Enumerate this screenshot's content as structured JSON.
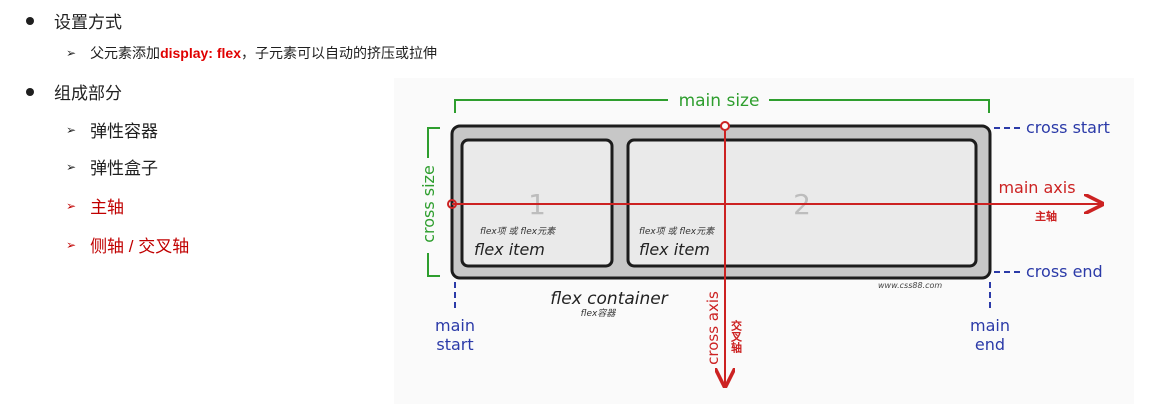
{
  "outline": {
    "setup": {
      "label": "设置方式",
      "detail_prefix": "父元素添加 ",
      "detail_code": "display: flex",
      "detail_suffix": "，子元素可以自动的挤压或拉伸"
    },
    "parts": {
      "label": "组成部分",
      "items": [
        "弹性容器",
        "弹性盒子",
        "主轴",
        "侧轴 / 交叉轴"
      ]
    }
  },
  "diagram": {
    "main_size": "main size",
    "cross_size": "cross size",
    "cross_start": "cross start",
    "cross_end": "cross end",
    "main_axis": "main axis",
    "main_axis_cn": "主轴",
    "cross_axis": "cross axis",
    "cross_axis_cn": "交叉轴",
    "main_start": [
      "main",
      "start"
    ],
    "main_end": [
      "main",
      "end"
    ],
    "item1_number": "1",
    "item2_number": "2",
    "item_caption_cn": "flex项 或 flex元素",
    "item_caption": "flex item",
    "container_label": "flex container",
    "container_label_cn": "flex容器",
    "watermark": "www.css88.com",
    "colors": {
      "green": "#2e9e2e",
      "blue": "#2b3aa8",
      "red": "#cc2222"
    }
  }
}
